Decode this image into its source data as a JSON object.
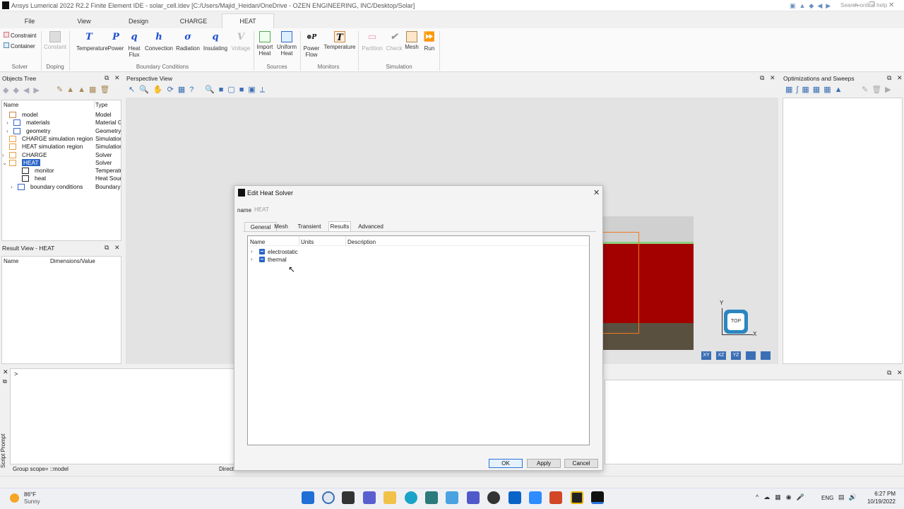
{
  "window": {
    "title": "Ansys Lumerical 2022 R2.2 Finite Element IDE - solar_cell.ldev [C:/Users/Majid_Heidari/OneDrive - OZEN ENGINEERING, INC/Desktop/Solar]",
    "search_placeholder": "Search online help"
  },
  "ribbon_tabs": [
    "File",
    "View",
    "Design",
    "CHARGE",
    "HEAT"
  ],
  "solver_group": {
    "constraint": "Constraint",
    "container": "Container",
    "label": "Solver"
  },
  "doping_group": {
    "constant": "Constant",
    "label": "Doping"
  },
  "bc_group": {
    "label": "Boundary Conditions",
    "items": [
      "Temperature",
      "Power",
      "Heat\nFlux",
      "Convection",
      "Radiation",
      "Insulating",
      "Voltage"
    ]
  },
  "sources_group": {
    "label": "Sources",
    "items": [
      "Import\nHeat",
      "Uniform\nHeat"
    ]
  },
  "monitors_group": {
    "label": "Monitors",
    "items": [
      "Power\nFlow",
      "Temperature"
    ]
  },
  "simulation_group": {
    "label": "Simulation",
    "items": [
      "Partition",
      "Check",
      "Mesh",
      "Run"
    ]
  },
  "objects_tree": {
    "title": "Objects Tree",
    "col_name": "Name",
    "col_type": "Type",
    "rows": [
      {
        "name": "model",
        "type": "Model"
      },
      {
        "name": "materials",
        "type": "Material G"
      },
      {
        "name": "geometry",
        "type": "Geometry"
      },
      {
        "name": "CHARGE simulation region",
        "type": "Simulation"
      },
      {
        "name": "HEAT simulation region",
        "type": "Simulation"
      },
      {
        "name": "CHARGE",
        "type": "Solver"
      },
      {
        "name": "HEAT",
        "type": "Solver"
      },
      {
        "name": "monitor",
        "type": "Temperatu"
      },
      {
        "name": "heat",
        "type": "Heat Sourc"
      },
      {
        "name": "boundary conditions",
        "type": "Boundary"
      }
    ]
  },
  "result_view": {
    "title": "Result View - HEAT",
    "col_name": "Name",
    "col_dim": "Dimensions/Value"
  },
  "perspective": {
    "title": "Perspective View",
    "gizmo_top": "TOP",
    "axis_y": "Y",
    "axis_x": "X",
    "view_buttons": [
      "XY",
      "XZ",
      "YZ"
    ]
  },
  "optimizations": {
    "title": "Optimizations and Sweeps"
  },
  "script": {
    "prompt": ">",
    "side_label": "Script Prompt",
    "status": "Group scope= ::model",
    "status_right": "Direct"
  },
  "dialog": {
    "title": "Edit Heat Solver",
    "name_label": "name",
    "name_value": "HEAT",
    "tabs": [
      "General",
      "Mesh",
      "Transient",
      "Results",
      "Advanced"
    ],
    "active_tab": "Results",
    "columns": [
      "Name",
      "Units",
      "Description"
    ],
    "results": [
      {
        "name": "electrostatic",
        "checked": true
      },
      {
        "name": "thermal",
        "checked": true
      }
    ],
    "ok": "OK",
    "apply": "Apply",
    "cancel": "Cancel"
  },
  "taskbar": {
    "weather_temp": "86°F",
    "weather_desc": "Sunny",
    "lang": "ENG",
    "time": "6:27 PM",
    "date": "10/19/2022"
  }
}
